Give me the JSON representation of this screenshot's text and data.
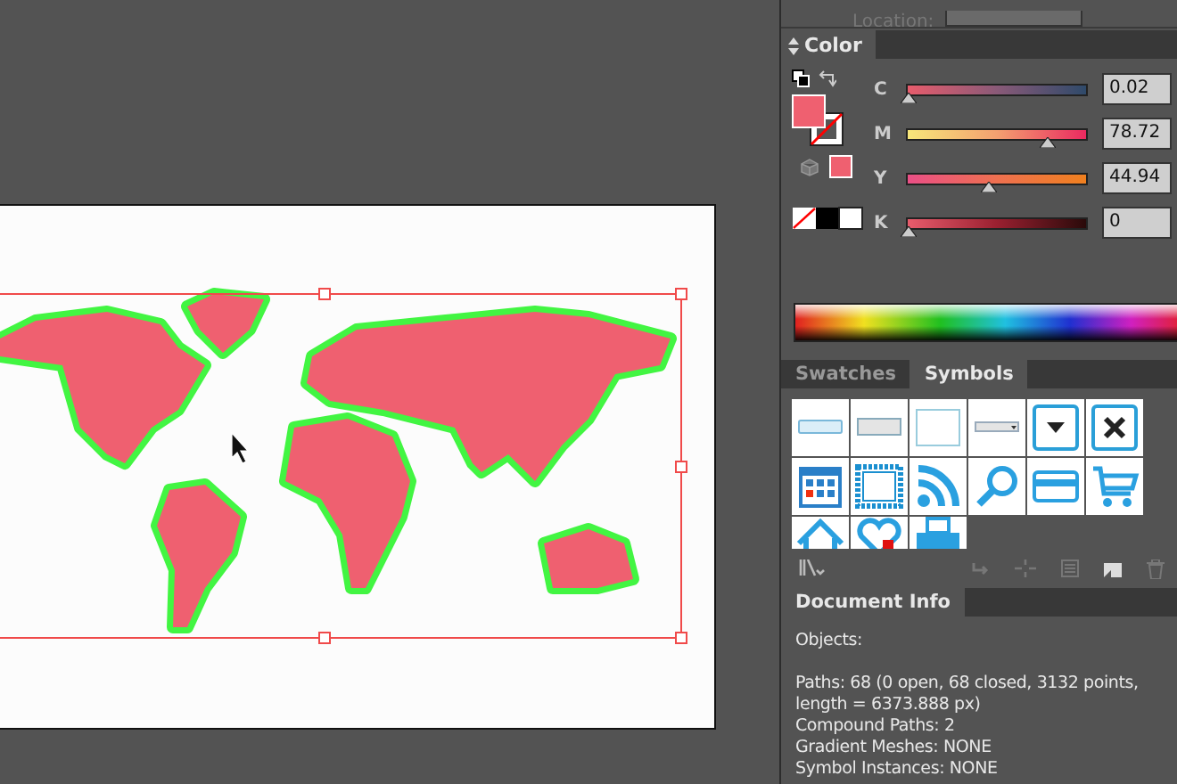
{
  "location": {
    "label": "Location:"
  },
  "color_panel": {
    "title": "Color",
    "sliders": [
      {
        "label": "C",
        "level": 0.0,
        "reading": "0.02"
      },
      {
        "label": "M",
        "level": 0.78,
        "reading": "78.72"
      },
      {
        "label": "Y",
        "level": 0.45,
        "reading": "44.94"
      },
      {
        "label": "K",
        "level": 0.0,
        "reading": "0"
      }
    ]
  },
  "tabs": [
    {
      "label": "Swatches",
      "selected": false
    },
    {
      "label": "Symbols",
      "selected": true
    }
  ],
  "document_info": {
    "title": "Document Info",
    "heading": "Objects:",
    "lines": [
      "Paths: 68 (0 open, 68 closed, 3132 points, length = 6373.888 px)",
      "Compound Paths: 2",
      "Gradient Meshes: NONE",
      "Symbol Instances: NONE"
    ]
  }
}
